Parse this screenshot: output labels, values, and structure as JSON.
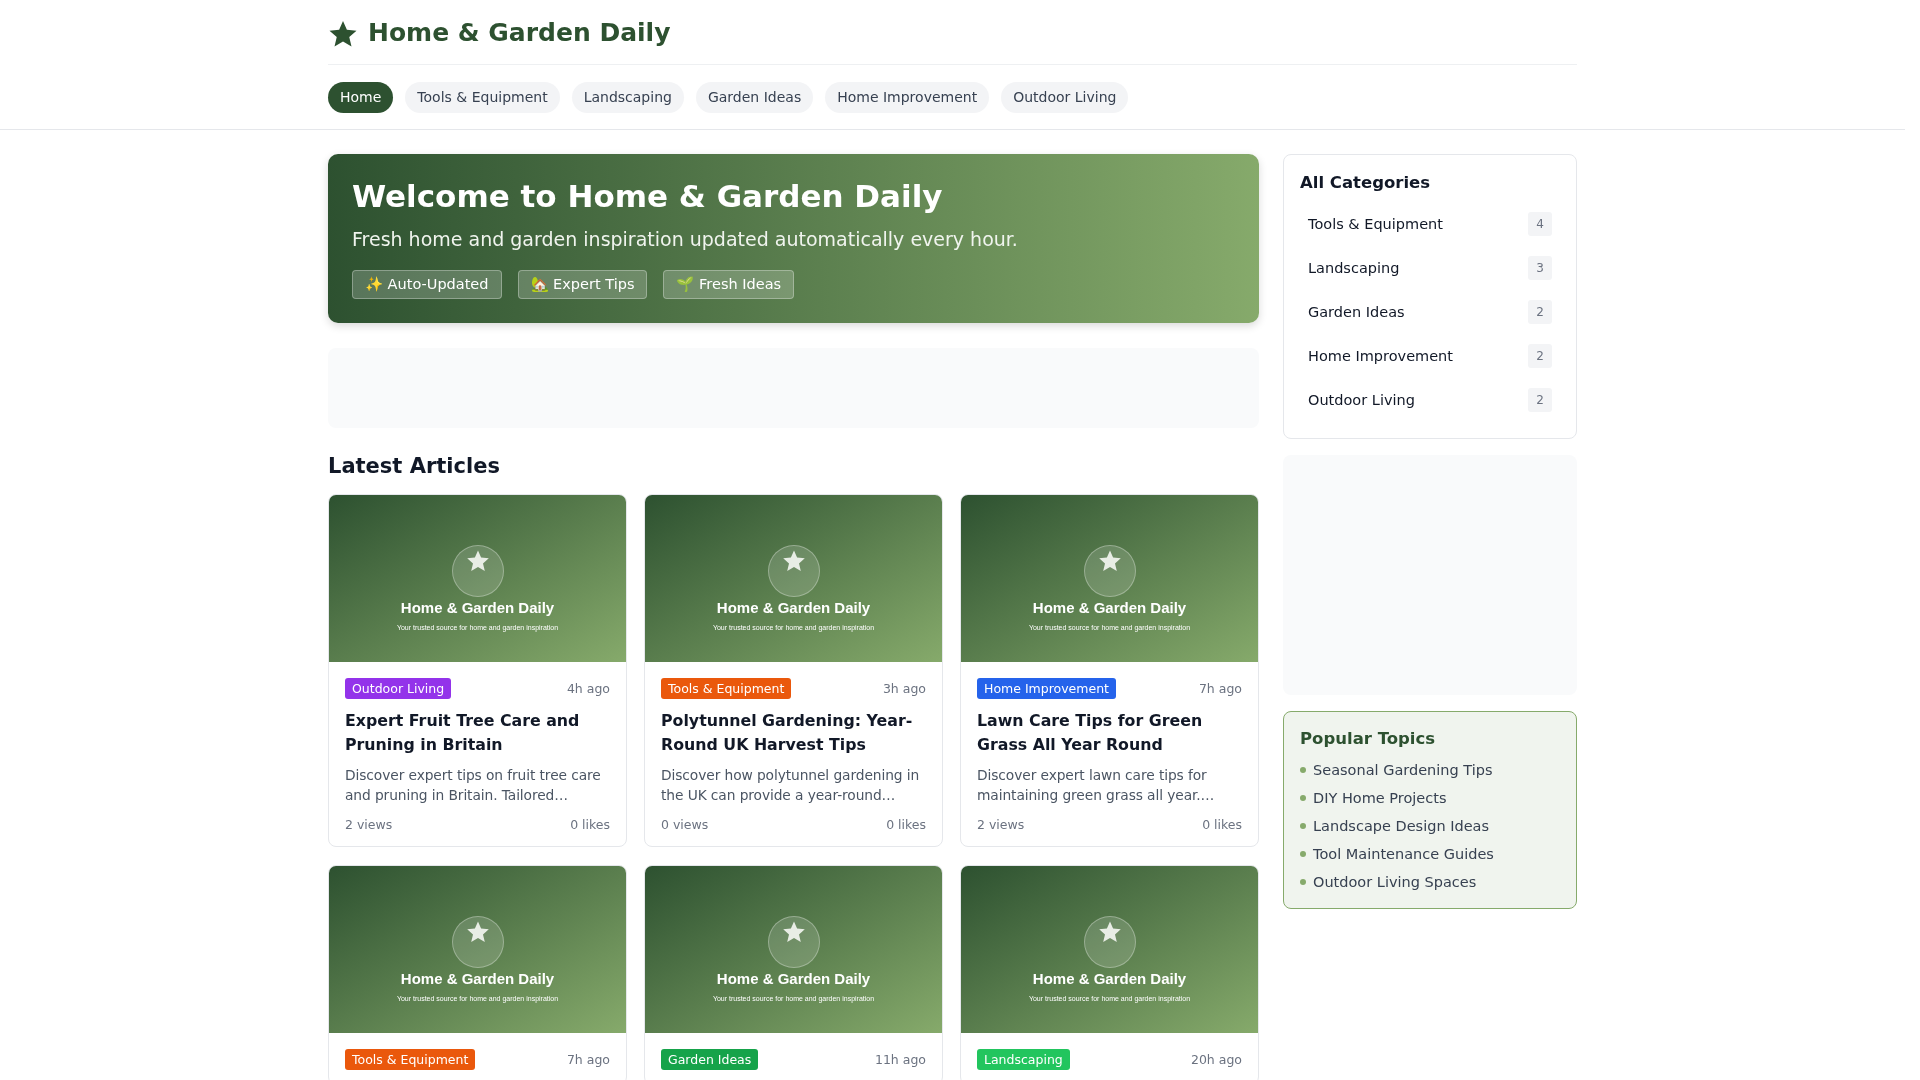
{
  "site": {
    "title": "Home & Garden Daily"
  },
  "nav": [
    {
      "label": "Home",
      "selected": true
    },
    {
      "label": "Tools & Equipment",
      "selected": false
    },
    {
      "label": "Landscaping",
      "selected": false
    },
    {
      "label": "Garden Ideas",
      "selected": false
    },
    {
      "label": "Home Improvement",
      "selected": false
    },
    {
      "label": "Outdoor Living",
      "selected": false
    }
  ],
  "hero": {
    "title": "Welcome to Home & Garden Daily",
    "subtitle": "Fresh home and garden inspiration updated automatically every hour.",
    "badges": [
      "✨ Auto-Updated",
      "🏡 Expert Tips",
      "🌱 Fresh Ideas"
    ]
  },
  "latest": {
    "heading": "Latest Articles",
    "articles": [
      {
        "banner_title": "Home & Garden Daily",
        "banner_subtitle": "Your trusted source for home and garden inspiration",
        "category": "Outdoor Living",
        "color": "#9333ea",
        "time": "4h ago",
        "title": "Expert Fruit Tree Care and Pruning in Britain",
        "excerpt": "Discover expert tips on fruit tree care and pruning in Britain. Tailored…",
        "views": "2 views",
        "likes": "0 likes"
      },
      {
        "banner_title": "Home & Garden Daily",
        "banner_subtitle": "Your trusted source for home and garden inspiration",
        "category": "Tools & Equipment",
        "color": "#ea580c",
        "time": "3h ago",
        "title": "Polytunnel Gardening: Year-Round UK Harvest Tips",
        "excerpt": "Discover how polytunnel gardening in the UK can provide a year-round…",
        "views": "0 views",
        "likes": "0 likes"
      },
      {
        "banner_title": "Home & Garden Daily",
        "banner_subtitle": "Your trusted source for home and garden inspiration",
        "category": "Home Improvement",
        "color": "#2563eb",
        "time": "7h ago",
        "title": "Lawn Care Tips for Green Grass All Year Round",
        "excerpt": "Discover expert lawn care tips for maintaining green grass all year.…",
        "views": "2 views",
        "likes": "0 likes"
      },
      {
        "banner_title": "Home & Garden Daily",
        "banner_subtitle": "Your trusted source for home and garden inspiration",
        "category": "Tools & Equipment",
        "color": "#ea580c",
        "time": "7h ago"
      },
      {
        "banner_title": "Home & Garden Daily",
        "banner_subtitle": "Your trusted source for home and garden inspiration",
        "category": "Garden Ideas",
        "color": "#16a34a",
        "time": "11h ago"
      },
      {
        "banner_title": "Home & Garden Daily",
        "banner_subtitle": "Your trusted source for home and garden inspiration",
        "category": "Landscaping",
        "color": "#22c55e",
        "time": "20h ago"
      }
    ]
  },
  "sidebar": {
    "categories": {
      "heading": "All Categories",
      "items": [
        {
          "label": "Tools & Equipment",
          "count": "4"
        },
        {
          "label": "Landscaping",
          "count": "3"
        },
        {
          "label": "Garden Ideas",
          "count": "2"
        },
        {
          "label": "Home Improvement",
          "count": "2"
        },
        {
          "label": "Outdoor Living",
          "count": "2"
        }
      ]
    },
    "popular": {
      "heading": "Popular Topics",
      "items": [
        "Seasonal Gardening Tips",
        "DIY Home Projects",
        "Landscape Design Ideas",
        "Tool Maintenance Guides",
        "Outdoor Living Spaces"
      ]
    }
  }
}
